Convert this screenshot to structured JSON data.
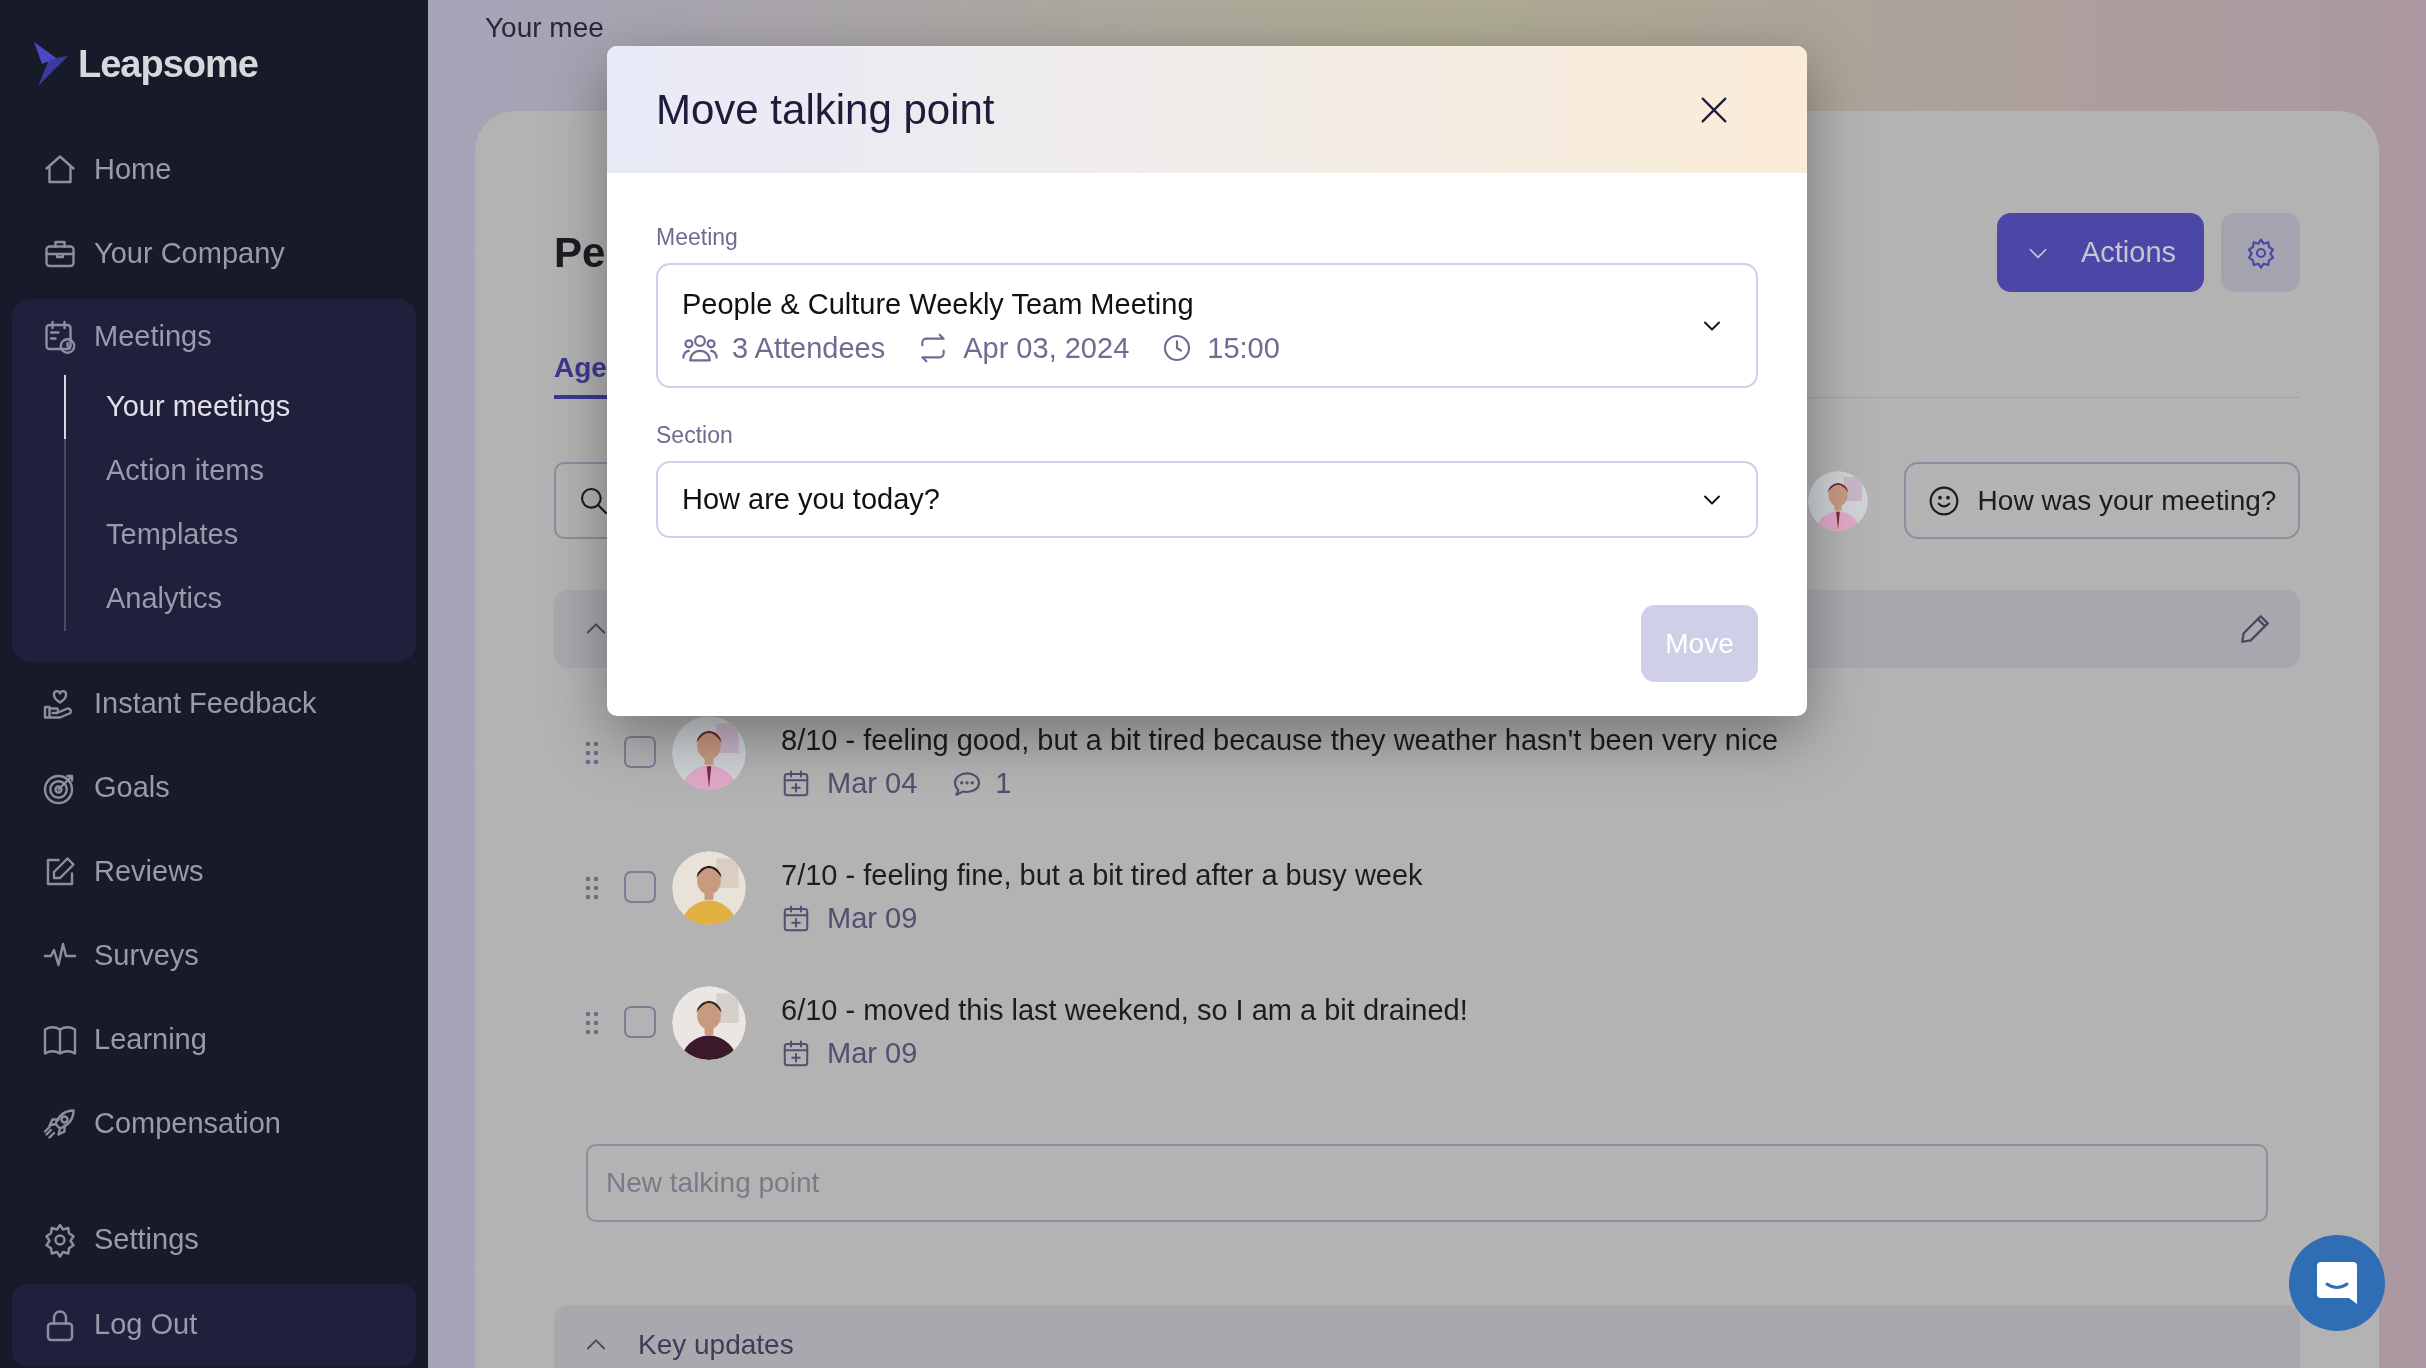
{
  "sidebar": {
    "logo": "Leapsome",
    "nav": [
      {
        "label": "Home",
        "expanded": false
      },
      {
        "label": "Your Company",
        "expanded": false
      },
      {
        "label": "Meetings",
        "expanded": true,
        "children": [
          {
            "label": "Your meetings",
            "selected": true
          },
          {
            "label": "Action items",
            "selected": false
          },
          {
            "label": "Templates",
            "selected": false
          },
          {
            "label": "Analytics",
            "selected": false
          }
        ]
      },
      {
        "label": "Instant Feedback",
        "expanded": false
      },
      {
        "label": "Goals",
        "expanded": false
      },
      {
        "label": "Reviews",
        "expanded": false
      },
      {
        "label": "Surveys",
        "expanded": false
      },
      {
        "label": "Learning",
        "expanded": false
      },
      {
        "label": "Compensation",
        "expanded": false
      }
    ],
    "footer": [
      {
        "label": "Settings",
        "hovered": false
      },
      {
        "label": "Log Out",
        "hovered": true
      }
    ]
  },
  "page": {
    "breadcrumb": "Your mee",
    "title": "Pe",
    "tabs": [
      {
        "label": "Age",
        "selected": true
      }
    ],
    "actions_label": "Actions",
    "feedback_label": "How was your meeting?",
    "talking_points": [
      {
        "text": "8/10 - feeling good, but a bit tired because they weather hasn't been very nice",
        "date": "Mar 04",
        "comments": "1",
        "checked": false
      },
      {
        "text": "7/10 - feeling fine, but a bit tired after a busy week",
        "date": "Mar 09",
        "checked": false
      },
      {
        "text": "6/10 - moved this last weekend, so I am a bit drained!",
        "date": "Mar 09",
        "checked": false
      }
    ],
    "new_point": {
      "placeholder": "New talking point"
    },
    "next_section": {
      "title": "Key updates"
    }
  },
  "modal": {
    "title": "Move talking point",
    "fields": [
      {
        "kind": "meeting",
        "label": "Meeting",
        "value": "People & Culture Weekly Team Meeting",
        "attendees": "3 Attendees",
        "date": "Apr 03, 2024",
        "time": "15:00"
      },
      {
        "kind": "select",
        "label": "Section",
        "value": "How are you today?"
      }
    ],
    "submit": {
      "label": "Move",
      "disabled": true
    }
  }
}
